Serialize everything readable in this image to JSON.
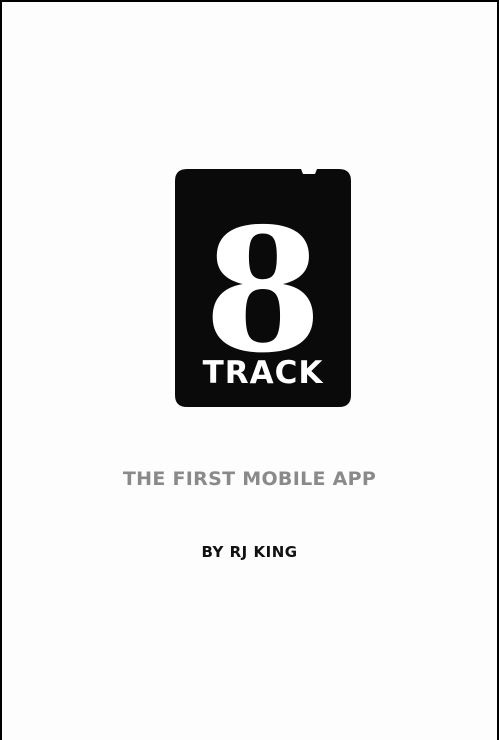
{
  "cover": {
    "logo": {
      "numeral": "8",
      "word": "TRACK"
    },
    "subtitle": "THE FIRST MOBILE APP",
    "author": "BY RJ KING"
  },
  "colors": {
    "logo_fill": "#0a0a0a",
    "logo_text": "#ffffff",
    "subtitle": "#8a8a8a",
    "author": "#111111",
    "background": "#fdfdfd"
  }
}
